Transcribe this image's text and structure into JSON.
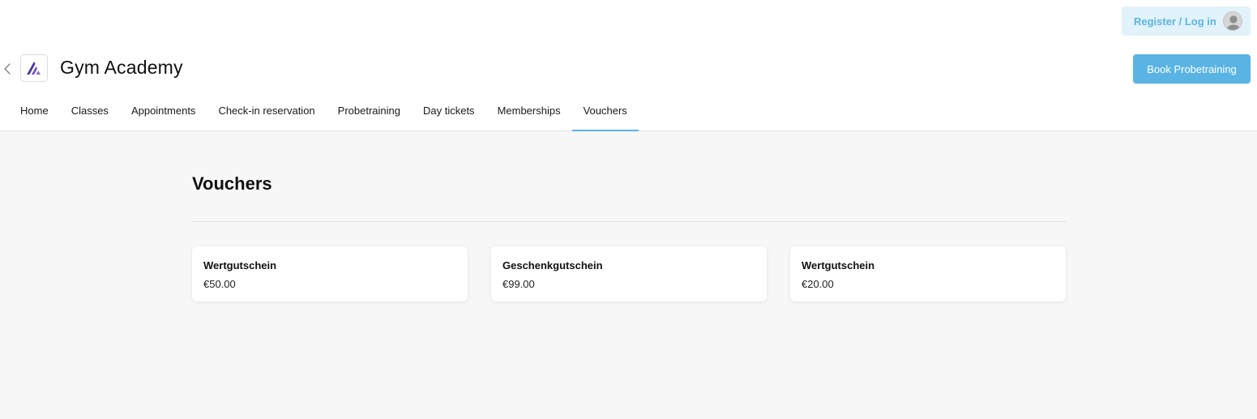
{
  "topbar": {
    "login_label": "Register / Log in"
  },
  "header": {
    "title": "Gym Academy",
    "book_label": "Book Probetraining"
  },
  "nav": {
    "items": [
      {
        "label": "Home"
      },
      {
        "label": "Classes"
      },
      {
        "label": "Appointments"
      },
      {
        "label": "Check-in reservation"
      },
      {
        "label": "Probetraining"
      },
      {
        "label": "Day tickets"
      },
      {
        "label": "Memberships"
      },
      {
        "label": "Vouchers"
      }
    ],
    "active_index": 7
  },
  "main": {
    "title": "Vouchers",
    "vouchers": [
      {
        "name": "Wertgutschein",
        "price": "€50.00"
      },
      {
        "name": "Geschenkgutschein",
        "price": "€99.00"
      },
      {
        "name": "Wertgutschein",
        "price": "€20.00"
      }
    ]
  },
  "colors": {
    "accent": "#5ab4e3",
    "login_bg": "#e1f2fa",
    "logo_purple": "#4b3a9c",
    "content_bg": "#f7f7f7"
  },
  "icons": {
    "back": "chevron-left-icon",
    "avatar": "user-avatar-icon",
    "logo": "gym-academy-logo"
  }
}
